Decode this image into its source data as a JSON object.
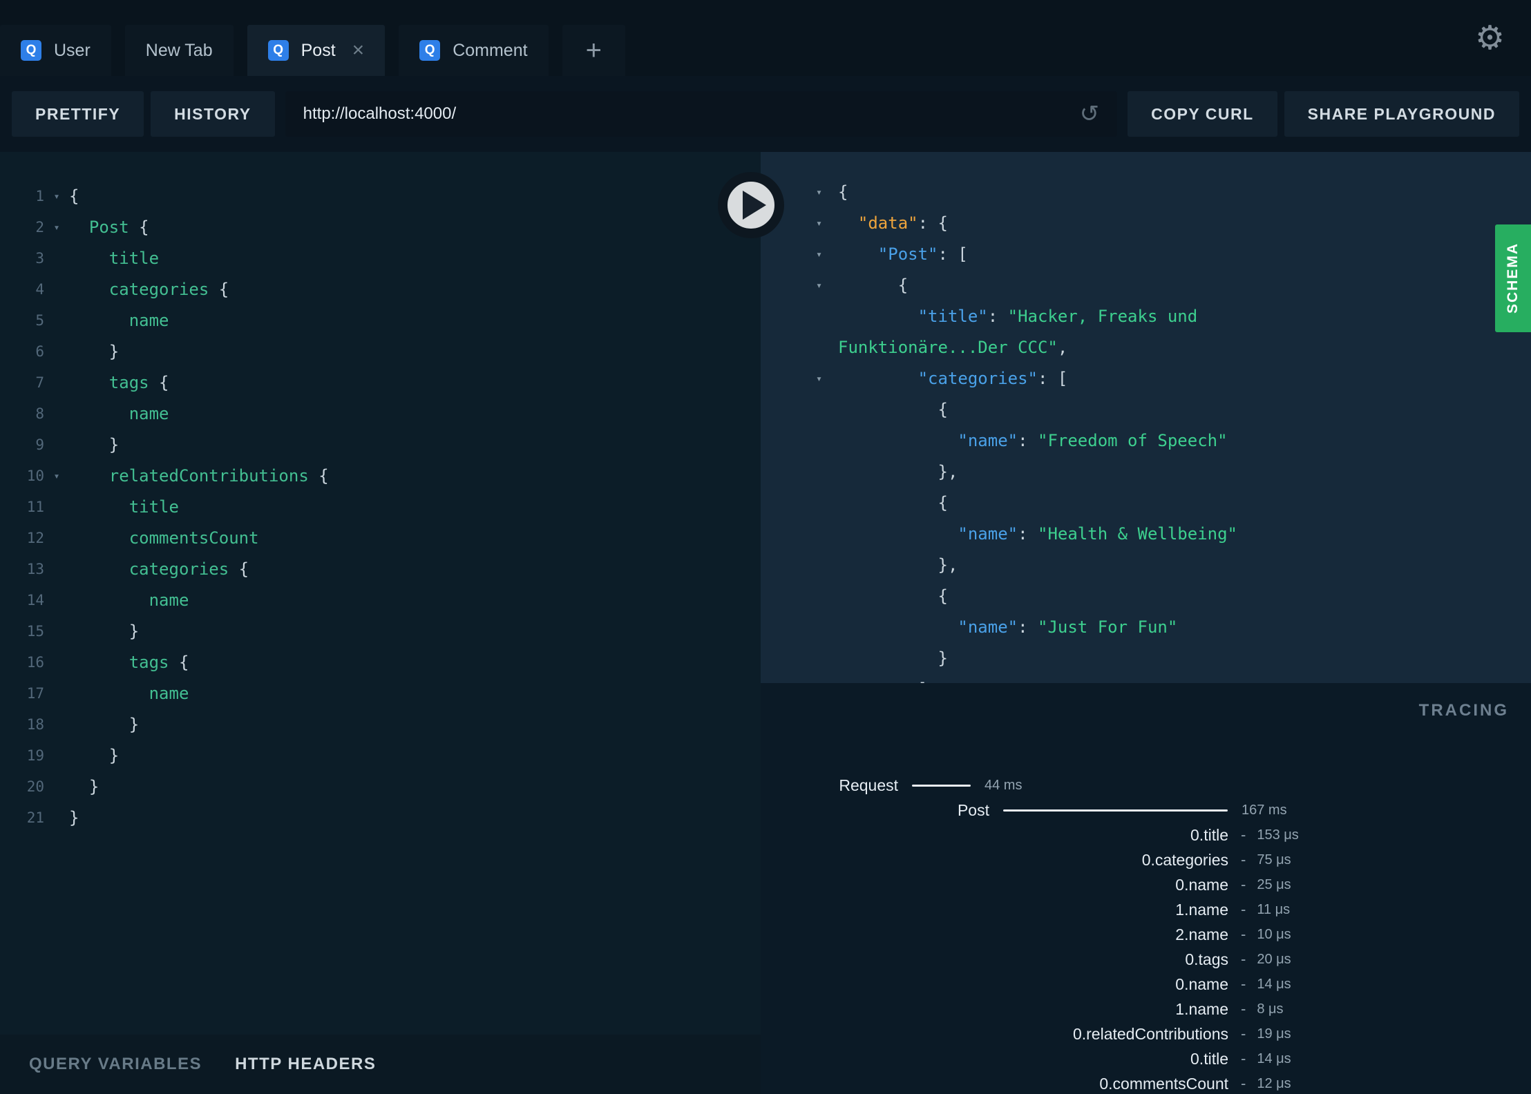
{
  "tabs": {
    "items": [
      {
        "label": "User",
        "has_q": true,
        "active": false,
        "closable": false
      },
      {
        "label": "New Tab",
        "has_q": false,
        "active": false,
        "closable": false
      },
      {
        "label": "Post",
        "has_q": true,
        "active": true,
        "closable": true
      },
      {
        "label": "Comment",
        "has_q": true,
        "active": false,
        "closable": false
      }
    ],
    "new_tab_label": "+"
  },
  "icons": {
    "q_badge": "Q",
    "close": "×",
    "gear": "⚙",
    "reload": "↺",
    "collapse_arrow": "▾",
    "fold_arrow": "▾"
  },
  "toolbar": {
    "prettify": "PRETTIFY",
    "history": "HISTORY",
    "url": "http://localhost:4000/",
    "copy_curl": "COPY CURL",
    "share": "SHARE PLAYGROUND"
  },
  "query": {
    "lines": [
      {
        "num": 1,
        "fold": true,
        "tokens": [
          [
            "p",
            "{"
          ]
        ]
      },
      {
        "num": 2,
        "fold": true,
        "tokens": [
          [
            "w",
            "  "
          ],
          [
            "f",
            "Post"
          ],
          [
            "p",
            " {"
          ]
        ]
      },
      {
        "num": 3,
        "fold": false,
        "tokens": [
          [
            "w",
            "    "
          ],
          [
            "f",
            "title"
          ]
        ]
      },
      {
        "num": 4,
        "fold": false,
        "tokens": [
          [
            "w",
            "    "
          ],
          [
            "f",
            "categories"
          ],
          [
            "p",
            " {"
          ]
        ]
      },
      {
        "num": 5,
        "fold": false,
        "tokens": [
          [
            "w",
            "      "
          ],
          [
            "f",
            "name"
          ]
        ]
      },
      {
        "num": 6,
        "fold": false,
        "tokens": [
          [
            "w",
            "    "
          ],
          [
            "p",
            "}"
          ]
        ]
      },
      {
        "num": 7,
        "fold": false,
        "tokens": [
          [
            "w",
            "    "
          ],
          [
            "f",
            "tags"
          ],
          [
            "p",
            " {"
          ]
        ]
      },
      {
        "num": 8,
        "fold": false,
        "tokens": [
          [
            "w",
            "      "
          ],
          [
            "f",
            "name"
          ]
        ]
      },
      {
        "num": 9,
        "fold": false,
        "tokens": [
          [
            "w",
            "    "
          ],
          [
            "p",
            "}"
          ]
        ]
      },
      {
        "num": 10,
        "fold": true,
        "tokens": [
          [
            "w",
            "    "
          ],
          [
            "f",
            "relatedContributions"
          ],
          [
            "p",
            " {"
          ]
        ]
      },
      {
        "num": 11,
        "fold": false,
        "tokens": [
          [
            "w",
            "      "
          ],
          [
            "f",
            "title"
          ]
        ]
      },
      {
        "num": 12,
        "fold": false,
        "tokens": [
          [
            "w",
            "      "
          ],
          [
            "f",
            "commentsCount"
          ]
        ]
      },
      {
        "num": 13,
        "fold": false,
        "tokens": [
          [
            "w",
            "      "
          ],
          [
            "f",
            "categories"
          ],
          [
            "p",
            " {"
          ]
        ]
      },
      {
        "num": 14,
        "fold": false,
        "tokens": [
          [
            "w",
            "        "
          ],
          [
            "f",
            "name"
          ]
        ]
      },
      {
        "num": 15,
        "fold": false,
        "tokens": [
          [
            "w",
            "      "
          ],
          [
            "p",
            "}"
          ]
        ]
      },
      {
        "num": 16,
        "fold": false,
        "tokens": [
          [
            "w",
            "      "
          ],
          [
            "f",
            "tags"
          ],
          [
            "p",
            " {"
          ]
        ]
      },
      {
        "num": 17,
        "fold": false,
        "tokens": [
          [
            "w",
            "        "
          ],
          [
            "f",
            "name"
          ]
        ]
      },
      {
        "num": 18,
        "fold": false,
        "tokens": [
          [
            "w",
            "      "
          ],
          [
            "p",
            "}"
          ]
        ]
      },
      {
        "num": 19,
        "fold": false,
        "tokens": [
          [
            "w",
            "    "
          ],
          [
            "p",
            "}"
          ]
        ]
      },
      {
        "num": 20,
        "fold": false,
        "tokens": [
          [
            "w",
            "  "
          ],
          [
            "p",
            "}"
          ]
        ]
      },
      {
        "num": 21,
        "fold": false,
        "tokens": [
          [
            "p",
            "}"
          ]
        ]
      }
    ]
  },
  "response": {
    "lines": [
      {
        "arrow": true,
        "tokens": [
          [
            "p",
            "{"
          ]
        ]
      },
      {
        "arrow": true,
        "tokens": [
          [
            "w",
            "  "
          ],
          [
            "ko",
            "\"data\""
          ],
          [
            "p",
            ": {"
          ]
        ]
      },
      {
        "arrow": true,
        "tokens": [
          [
            "w",
            "    "
          ],
          [
            "kb",
            "\"Post\""
          ],
          [
            "p",
            ": ["
          ]
        ]
      },
      {
        "arrow": true,
        "tokens": [
          [
            "w",
            "      "
          ],
          [
            "p",
            "{"
          ]
        ]
      },
      {
        "arrow": false,
        "tokens": [
          [
            "w",
            "        "
          ],
          [
            "kb",
            "\"title\""
          ],
          [
            "p",
            ": "
          ],
          [
            "s",
            "\"Hacker, Freaks und"
          ]
        ]
      },
      {
        "arrow": false,
        "tokens": [
          [
            "s",
            "Funktionäre...Der CCC\""
          ],
          [
            "p",
            ","
          ]
        ]
      },
      {
        "arrow": true,
        "tokens": [
          [
            "w",
            "        "
          ],
          [
            "kb",
            "\"categories\""
          ],
          [
            "p",
            ": ["
          ]
        ]
      },
      {
        "arrow": false,
        "tokens": [
          [
            "w",
            "          "
          ],
          [
            "p",
            "{"
          ]
        ]
      },
      {
        "arrow": false,
        "tokens": [
          [
            "w",
            "            "
          ],
          [
            "kb",
            "\"name\""
          ],
          [
            "p",
            ": "
          ],
          [
            "s",
            "\"Freedom of Speech\""
          ]
        ]
      },
      {
        "arrow": false,
        "tokens": [
          [
            "w",
            "          "
          ],
          [
            "p",
            "},"
          ]
        ]
      },
      {
        "arrow": false,
        "tokens": [
          [
            "w",
            "          "
          ],
          [
            "p",
            "{"
          ]
        ]
      },
      {
        "arrow": false,
        "tokens": [
          [
            "w",
            "            "
          ],
          [
            "kb",
            "\"name\""
          ],
          [
            "p",
            ": "
          ],
          [
            "s",
            "\"Health & Wellbeing\""
          ]
        ]
      },
      {
        "arrow": false,
        "tokens": [
          [
            "w",
            "          "
          ],
          [
            "p",
            "},"
          ]
        ]
      },
      {
        "arrow": false,
        "tokens": [
          [
            "w",
            "          "
          ],
          [
            "p",
            "{"
          ]
        ]
      },
      {
        "arrow": false,
        "tokens": [
          [
            "w",
            "            "
          ],
          [
            "kb",
            "\"name\""
          ],
          [
            "p",
            ": "
          ],
          [
            "s",
            "\"Just For Fun\""
          ]
        ]
      },
      {
        "arrow": false,
        "tokens": [
          [
            "w",
            "          "
          ],
          [
            "p",
            "}"
          ]
        ]
      },
      {
        "arrow": false,
        "tokens": [
          [
            "w",
            "        "
          ],
          [
            "p",
            "],"
          ]
        ]
      }
    ]
  },
  "schema_tab": {
    "label": "SCHEMA"
  },
  "tracing": {
    "title": "TRACING",
    "rows": [
      {
        "label": "Request",
        "time": "44 ms",
        "label_w": 199,
        "line_w": 85
      },
      {
        "label": "Post",
        "time": "167 ms",
        "label_w": 331,
        "line_w": 325
      },
      {
        "label": "0.title",
        "time": "153 μs",
        "label_w": 677
      },
      {
        "label": "0.categories",
        "time": "75 μs",
        "label_w": 677
      },
      {
        "label": "0.name",
        "time": "25 μs",
        "label_w": 677
      },
      {
        "label": "1.name",
        "time": "11 μs",
        "label_w": 677
      },
      {
        "label": "2.name",
        "time": "10 μs",
        "label_w": 677
      },
      {
        "label": "0.tags",
        "time": "20 μs",
        "label_w": 677
      },
      {
        "label": "0.name",
        "time": "14 μs",
        "label_w": 677
      },
      {
        "label": "1.name",
        "time": "8 μs",
        "label_w": 677
      },
      {
        "label": "0.relatedContributions",
        "time": "19 μs",
        "label_w": 677
      },
      {
        "label": "0.title",
        "time": "14 μs",
        "label_w": 677
      },
      {
        "label": "0.commentsCount",
        "time": "12 μs",
        "label_w": 677
      }
    ]
  },
  "footer": {
    "query_variables": "QUERY VARIABLES",
    "http_headers": "HTTP HEADERS"
  },
  "colors": {
    "q_badge_blue": "#2e7fe8",
    "schema_green": "#27ae60",
    "query_field_green": "#43bf92",
    "response_key_blue": "#4aa1e8",
    "response_data_orange": "#eea43c",
    "response_string_green": "#3dd08f"
  }
}
